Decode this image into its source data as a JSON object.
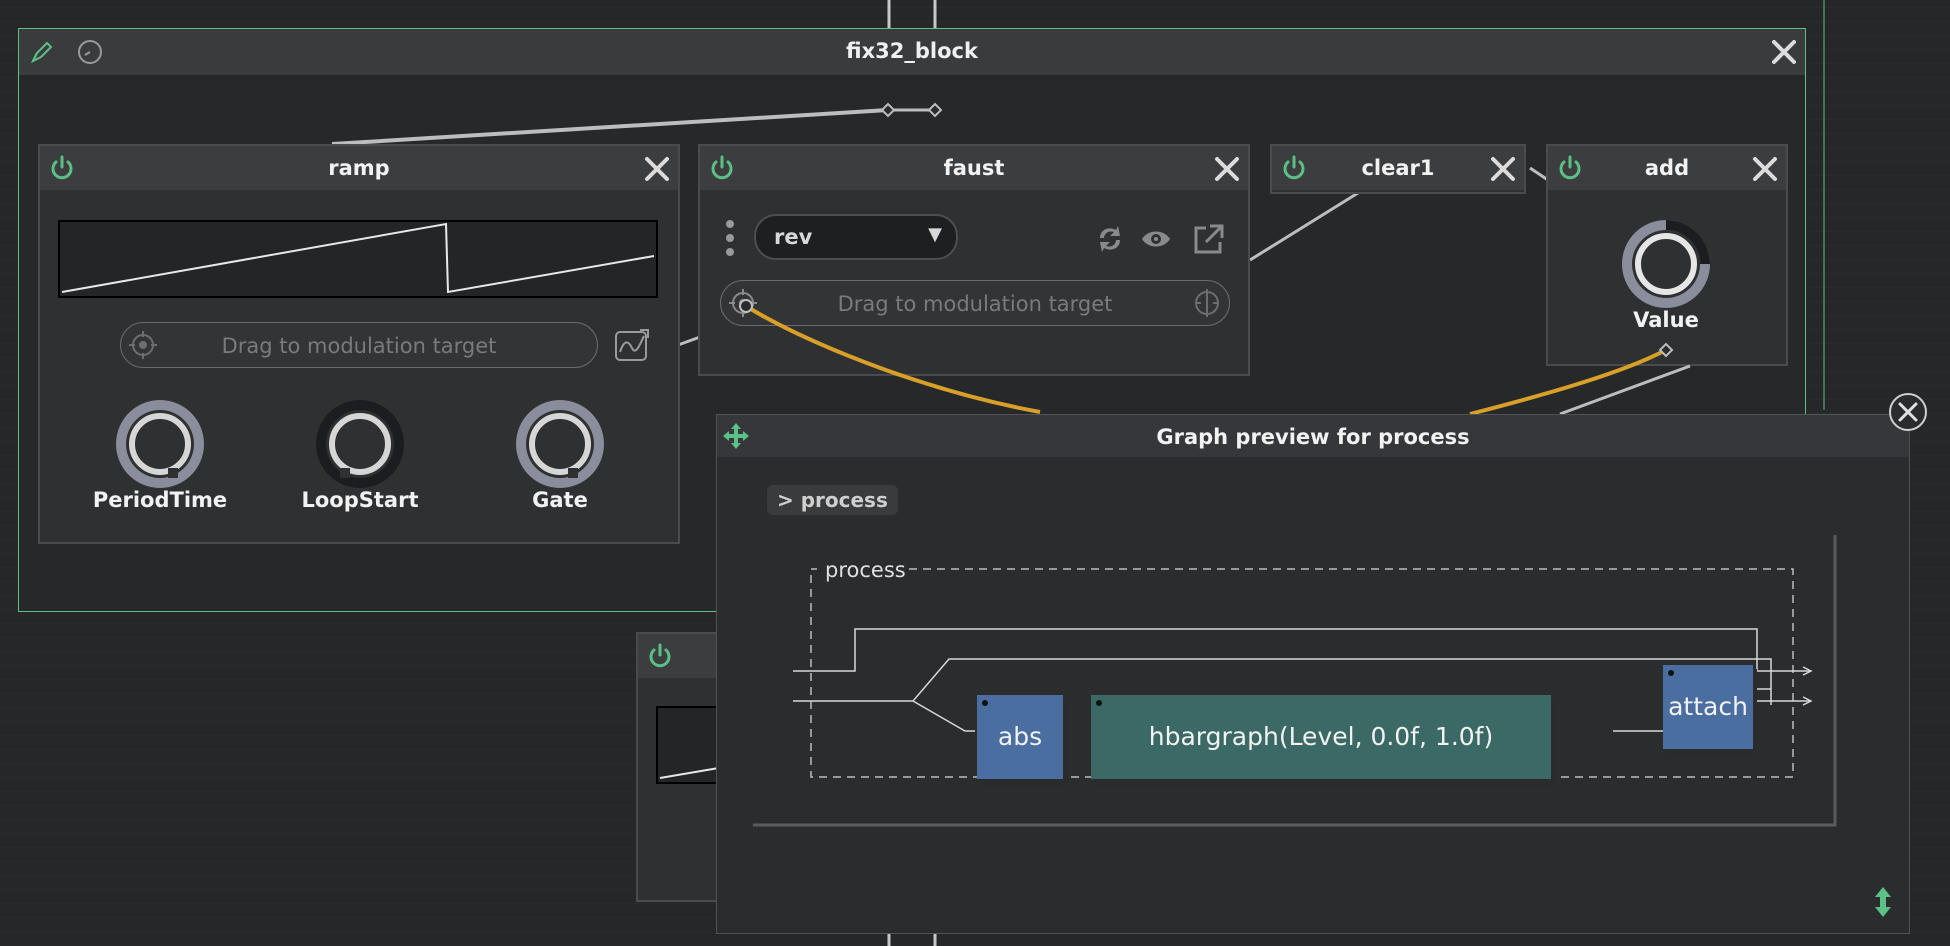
{
  "block": {
    "title": "fix32_block"
  },
  "nodes": {
    "ramp": {
      "title": "ramp",
      "modulation_hint": "Drag to modulation target",
      "knobs": [
        "PeriodTime",
        "LoopStart",
        "Gate"
      ]
    },
    "faust": {
      "title": "faust",
      "program": "rev",
      "modulation_hint": "Drag to modulation target"
    },
    "clear1": {
      "title": "clear1"
    },
    "add": {
      "title": "add",
      "knob": "Value"
    }
  },
  "preview": {
    "title": "Graph preview for process",
    "breadcrumb": "> process",
    "group_label": "process",
    "blocks": [
      "abs",
      "hbargraph(Level, 0.0f, 1.0f)",
      "attach"
    ]
  },
  "colors": {
    "accent_green": "#5cbf86",
    "wire": "#c0c0c0",
    "mod_wire": "#d8a028",
    "blue_block": "#4b6ea0",
    "teal_block": "#3b6a66"
  },
  "icons": [
    "pencil-icon",
    "clock-icon",
    "power-icon",
    "close-icon",
    "move-icon",
    "refresh-icon",
    "eye-icon",
    "external-link-icon",
    "target-icon",
    "sine-wave-icon",
    "resize-vertical-icon",
    "menu-dots-icon"
  ]
}
